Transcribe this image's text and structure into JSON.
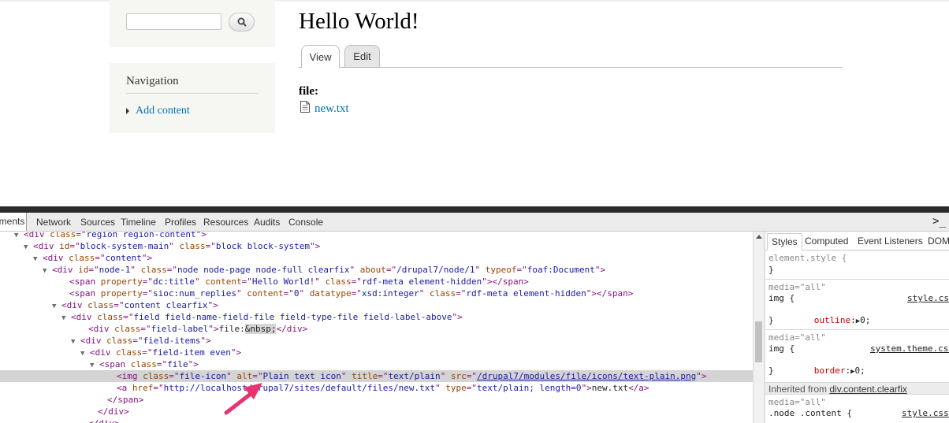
{
  "webpage": {
    "search": {
      "value": "",
      "placeholder": "",
      "button_icon": "search-icon"
    },
    "navigation": {
      "title": "Navigation",
      "items": [
        {
          "label": "Add content"
        }
      ]
    },
    "page_title": "Hello World!",
    "tabs": [
      {
        "label": "View",
        "active": true
      },
      {
        "label": "Edit",
        "active": false
      }
    ],
    "field_label": "file:",
    "file_link": "new.txt",
    "file_icon": "document-icon"
  },
  "devtools": {
    "tabs": [
      "ements",
      "Network",
      "Sources",
      "Timeline",
      "Profiles",
      "Resources",
      "Audits",
      "Console"
    ],
    "console_icon": ">_",
    "dom_lines": [
      {
        "tri": "▼",
        "segs": [
          {
            "c": "tag",
            "t": "<div "
          },
          {
            "c": "an",
            "t": "class"
          },
          {
            "c": "tag",
            "t": "=\""
          },
          {
            "c": "av",
            "t": "region region-content"
          },
          {
            "c": "tag",
            "t": "\">"
          }
        ]
      },
      {
        "tri": "▼",
        "segs": [
          {
            "c": "tag",
            "t": "<div "
          },
          {
            "c": "an",
            "t": "id"
          },
          {
            "c": "tag",
            "t": "=\""
          },
          {
            "c": "av",
            "t": "block-system-main"
          },
          {
            "c": "tag",
            "t": "\" "
          },
          {
            "c": "an",
            "t": "class"
          },
          {
            "c": "tag",
            "t": "=\""
          },
          {
            "c": "av",
            "t": "block block-system"
          },
          {
            "c": "tag",
            "t": "\">"
          }
        ]
      },
      {
        "tri": "▼",
        "segs": [
          {
            "c": "tag",
            "t": "<div "
          },
          {
            "c": "an",
            "t": "class"
          },
          {
            "c": "tag",
            "t": "=\""
          },
          {
            "c": "av",
            "t": "content"
          },
          {
            "c": "tag",
            "t": "\">"
          }
        ]
      },
      {
        "tri": "▼",
        "segs": [
          {
            "c": "tag",
            "t": "<div "
          },
          {
            "c": "an",
            "t": "id"
          },
          {
            "c": "tag",
            "t": "=\""
          },
          {
            "c": "av",
            "t": "node-1"
          },
          {
            "c": "tag",
            "t": "\" "
          },
          {
            "c": "an",
            "t": "class"
          },
          {
            "c": "tag",
            "t": "=\""
          },
          {
            "c": "av",
            "t": "node node-page node-full clearfix"
          },
          {
            "c": "tag",
            "t": "\" "
          },
          {
            "c": "an",
            "t": "about"
          },
          {
            "c": "tag",
            "t": "=\""
          },
          {
            "c": "av",
            "t": "/drupal7/node/1"
          },
          {
            "c": "tag",
            "t": "\" "
          },
          {
            "c": "an",
            "t": "typeof"
          },
          {
            "c": "tag",
            "t": "=\""
          },
          {
            "c": "av",
            "t": "foaf:Document"
          },
          {
            "c": "tag",
            "t": "\">"
          }
        ]
      },
      {
        "tri": "",
        "segs": [
          {
            "c": "tag",
            "t": "<span "
          },
          {
            "c": "an",
            "t": "property"
          },
          {
            "c": "tag",
            "t": "=\""
          },
          {
            "c": "av",
            "t": "dc:title"
          },
          {
            "c": "tag",
            "t": "\" "
          },
          {
            "c": "an",
            "t": "content"
          },
          {
            "c": "tag",
            "t": "=\""
          },
          {
            "c": "av",
            "t": "Hello World!"
          },
          {
            "c": "tag",
            "t": "\" "
          },
          {
            "c": "an",
            "t": "class"
          },
          {
            "c": "tag",
            "t": "=\""
          },
          {
            "c": "av",
            "t": "rdf-meta element-hidden"
          },
          {
            "c": "tag",
            "t": "\"></span>"
          }
        ]
      },
      {
        "tri": "",
        "segs": [
          {
            "c": "tag",
            "t": "<span "
          },
          {
            "c": "an",
            "t": "property"
          },
          {
            "c": "tag",
            "t": "=\""
          },
          {
            "c": "av",
            "t": "sioc:num_replies"
          },
          {
            "c": "tag",
            "t": "\" "
          },
          {
            "c": "an",
            "t": "content"
          },
          {
            "c": "tag",
            "t": "=\""
          },
          {
            "c": "av",
            "t": "0"
          },
          {
            "c": "tag",
            "t": "\" "
          },
          {
            "c": "an",
            "t": "datatype"
          },
          {
            "c": "tag",
            "t": "=\""
          },
          {
            "c": "av",
            "t": "xsd:integer"
          },
          {
            "c": "tag",
            "t": "\" "
          },
          {
            "c": "an",
            "t": "class"
          },
          {
            "c": "tag",
            "t": "=\""
          },
          {
            "c": "av",
            "t": "rdf-meta element-hidden"
          },
          {
            "c": "tag",
            "t": "\"></span>"
          }
        ]
      },
      {
        "tri": "▼",
        "segs": [
          {
            "c": "tag",
            "t": "<div "
          },
          {
            "c": "an",
            "t": "class"
          },
          {
            "c": "tag",
            "t": "=\""
          },
          {
            "c": "av",
            "t": "content clearfix"
          },
          {
            "c": "tag",
            "t": "\">"
          }
        ]
      },
      {
        "tri": "▼",
        "segs": [
          {
            "c": "tag",
            "t": "<div "
          },
          {
            "c": "an",
            "t": "class"
          },
          {
            "c": "tag",
            "t": "=\""
          },
          {
            "c": "av",
            "t": "field field-name-field-file field-type-file field-label-above"
          },
          {
            "c": "tag",
            "t": "\">"
          }
        ]
      },
      {
        "tri": "",
        "segs": [
          {
            "c": "tag",
            "t": "<div "
          },
          {
            "c": "an",
            "t": "class"
          },
          {
            "c": "tag",
            "t": "=\""
          },
          {
            "c": "av",
            "t": "field-label"
          },
          {
            "c": "tag",
            "t": "\">"
          },
          {
            "c": "tx",
            "t": "file:"
          },
          {
            "c": "ent",
            "t": "&nbsp;"
          },
          {
            "c": "tag",
            "t": "</div>"
          }
        ]
      },
      {
        "tri": "▼",
        "segs": [
          {
            "c": "tag",
            "t": "<div "
          },
          {
            "c": "an",
            "t": "class"
          },
          {
            "c": "tag",
            "t": "=\""
          },
          {
            "c": "av",
            "t": "field-items"
          },
          {
            "c": "tag",
            "t": "\">"
          }
        ]
      },
      {
        "tri": "▼",
        "segs": [
          {
            "c": "tag",
            "t": "<div "
          },
          {
            "c": "an",
            "t": "class"
          },
          {
            "c": "tag",
            "t": "=\""
          },
          {
            "c": "av",
            "t": "field-item even"
          },
          {
            "c": "tag",
            "t": "\">"
          }
        ]
      },
      {
        "tri": "▼",
        "segs": [
          {
            "c": "tag",
            "t": "<span "
          },
          {
            "c": "an",
            "t": "class"
          },
          {
            "c": "tag",
            "t": "=\""
          },
          {
            "c": "av",
            "t": "file"
          },
          {
            "c": "tag",
            "t": "\">"
          }
        ]
      },
      {
        "tri": "",
        "selected": true,
        "segs": [
          {
            "c": "tag",
            "t": "<img "
          },
          {
            "c": "an",
            "t": "class"
          },
          {
            "c": "tag",
            "t": "=\""
          },
          {
            "c": "av",
            "t": "file-icon"
          },
          {
            "c": "tag",
            "t": "\" "
          },
          {
            "c": "an",
            "t": "alt"
          },
          {
            "c": "tag",
            "t": "=\""
          },
          {
            "c": "av",
            "t": "Plain text icon"
          },
          {
            "c": "tag",
            "t": "\" "
          },
          {
            "c": "an",
            "t": "title"
          },
          {
            "c": "tag",
            "t": "=\""
          },
          {
            "c": "av",
            "t": "text/plain"
          },
          {
            "c": "tag",
            "t": "\" "
          },
          {
            "c": "an",
            "t": "src"
          },
          {
            "c": "tag",
            "t": "=\""
          },
          {
            "c": "lnk",
            "t": "/drupal7/modules/file/icons/text-plain.png"
          },
          {
            "c": "tag",
            "t": "\">"
          }
        ]
      },
      {
        "tri": "",
        "segs": [
          {
            "c": "tag",
            "t": "<a "
          },
          {
            "c": "an",
            "t": "href"
          },
          {
            "c": "tag",
            "t": "=\""
          },
          {
            "c": "av",
            "t": "http://localhost/drupal7/sites/default/files/new.txt"
          },
          {
            "c": "tag",
            "t": "\" "
          },
          {
            "c": "an",
            "t": "type"
          },
          {
            "c": "tag",
            "t": "=\""
          },
          {
            "c": "av",
            "t": "text/plain; length=0"
          },
          {
            "c": "tag",
            "t": "\">"
          },
          {
            "c": "tx",
            "t": "new.txt"
          },
          {
            "c": "tag",
            "t": "</a>"
          }
        ]
      },
      {
        "tri": "",
        "segs": [
          {
            "c": "tag",
            "t": "</span>"
          }
        ]
      },
      {
        "tri": "",
        "segs": [
          {
            "c": "tag",
            "t": "</div>"
          }
        ]
      },
      {
        "tri": "",
        "segs": [
          {
            "c": "tag",
            "t": "</div>"
          }
        ]
      }
    ],
    "styles_tabs": [
      "Styles",
      "Computed",
      "Event Listeners",
      "DOM"
    ],
    "styles": {
      "element_style": "element.style {",
      "close_brace": "}",
      "rule1": {
        "media": "media=\"all\"",
        "selector": "img {",
        "source": "style.css",
        "prop": "outline",
        "value": "0;"
      },
      "rule2": {
        "media": "media=\"all\"",
        "selector": "img {",
        "source": "system.theme.css",
        "prop": "border",
        "value": "0;"
      },
      "inherited_label": "Inherited from ",
      "inherited_link": "div.content.clearfix",
      "rule3": {
        "media": "media=\"all\"",
        "selector": ".node .content {",
        "source": "style.css"
      }
    }
  },
  "annotation": {
    "arrow_color": "#e8336e"
  }
}
